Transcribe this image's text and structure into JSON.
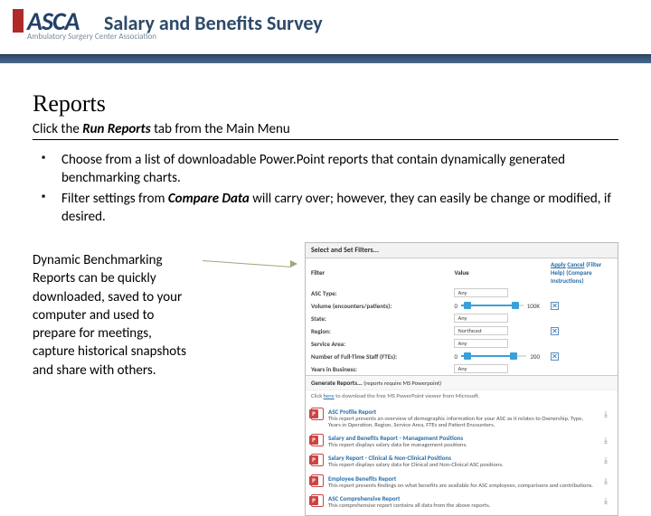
{
  "header": {
    "logo": "ASCA",
    "logo_sub": "Ambulatory Surgery\nCenter Association",
    "title": "Salary and Benefits Survey"
  },
  "page": {
    "title": "Reports",
    "subtitle_prefix": "Click the ",
    "subtitle_em": "Run Reports",
    "subtitle_suffix": " tab from the Main Menu"
  },
  "bullets": [
    {
      "text": "Choose from a list of downloadable Power.Point reports that contain dynamically generated benchmarking charts."
    },
    {
      "pre": "Filter settings from ",
      "em": "Compare Data",
      "post": " will carry over; however, they can easily be change or modified, if desired."
    }
  ],
  "caption": "Dynamic Benchmarking Reports can be quickly downloaded, saved to your computer and used to prepare for meetings, capture historical snapshots and share with others.",
  "panel": {
    "head": "Select and Set Filters...",
    "cols": {
      "filter": "Filter",
      "value": "Value",
      "apply": "Apply",
      "cancel": "Cancel",
      "help": "(Filter Help)",
      "instr": "(Compare Instructions)"
    },
    "filters": {
      "asc_type": {
        "name": "ASC Type:",
        "value": "Any"
      },
      "volume": {
        "name": "Volume (encounters/patients):",
        "min": "0",
        "max": "100K",
        "fillPct": 85,
        "minKnobPct": 4,
        "maxKnobPct": 82
      },
      "state": {
        "name": "State:",
        "value": "Any"
      },
      "region": {
        "name": "Region:",
        "value": "Northeast"
      },
      "service": {
        "name": "Service Area:",
        "value": "Any"
      },
      "fte": {
        "name": "Number of Full-Time Staff (FTEs):",
        "min": "0",
        "max": "200",
        "fillPct": 78,
        "minKnobPct": 4,
        "maxKnobPct": 75
      },
      "years": {
        "name": "Years in Business:",
        "value": "Any"
      }
    },
    "gen_head": "Generate Reports...",
    "gen_head_note": "(reports require MS Powerpoint)",
    "click_here_pre": "Click ",
    "click_here_link": "here",
    "click_here_post": " to download the free MS PowerPoint viewer from Microsoft.",
    "reports": [
      {
        "title": "ASC Profile Report",
        "desc": "This report presents an overview of demographic information for your ASC as it relates to Ownership, Type, Years in Operation, Region, Service Area, FTEs and Patient Encounters."
      },
      {
        "title": "Salary and Benefits Report - Management Positions",
        "desc": "This report displays salary data for management positions."
      },
      {
        "title": "Salary Report - Clinical & Non-Clinical Positions",
        "desc": "This report displays salary data for Clinical and Non-Clinical ASC positions."
      },
      {
        "title": "Employee Benefits Report",
        "desc": "This report presents findings on what benefits are available for ASC employees, comparisons and contributions."
      },
      {
        "title": "ASC Comprehensive Report",
        "desc": "This comprehensive report contains all data from the above reports."
      }
    ]
  }
}
